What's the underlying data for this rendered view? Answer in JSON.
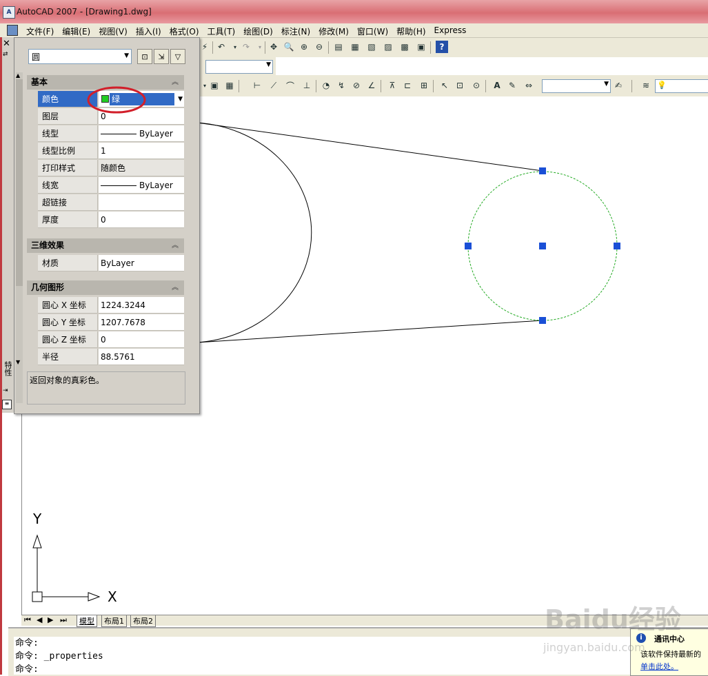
{
  "window": {
    "title": "AutoCAD 2007 - [Drawing1.dwg]",
    "app_icon": "autocad-logo"
  },
  "menu": [
    "文件(F)",
    "编辑(E)",
    "视图(V)",
    "插入(I)",
    "格式(O)",
    "工具(T)",
    "绘图(D)",
    "标注(N)",
    "修改(M)",
    "窗口(W)",
    "帮助(H)",
    "Express"
  ],
  "palette": {
    "object_type": "圆",
    "sections": {
      "basic": "基本",
      "effects3d": "三维效果",
      "geometry": "几何图形"
    },
    "basic": [
      {
        "key": "颜色",
        "value": "绿"
      },
      {
        "key": "图层",
        "value": "0"
      },
      {
        "key": "线型",
        "value": "ByLayer"
      },
      {
        "key": "线型比例",
        "value": "1"
      },
      {
        "key": "打印样式",
        "value": "随颜色"
      },
      {
        "key": "线宽",
        "value": "ByLayer"
      },
      {
        "key": "超链接",
        "value": ""
      },
      {
        "key": "厚度",
        "value": "0"
      }
    ],
    "effects3d": [
      {
        "key": "材质",
        "value": "ByLayer"
      }
    ],
    "geometry": [
      {
        "key": "圆心 X 坐标",
        "value": "1224.3244"
      },
      {
        "key": "圆心 Y 坐标",
        "value": "1207.7678"
      },
      {
        "key": "圆心 Z 坐标",
        "value": "0"
      },
      {
        "key": "半径",
        "value": "88.5761"
      }
    ],
    "description": "返回对象的真彩色。",
    "side_label": "特性",
    "color_swatch": "#22cc22",
    "highlight_color": "#316ac5"
  },
  "layout_tabs": [
    "模型",
    "布局1",
    "布局2"
  ],
  "ucs": {
    "x": "X",
    "y": "Y"
  },
  "command_lines": [
    "命令:",
    "命令: _properties",
    "命令:"
  ],
  "notification": {
    "title": "通讯中心",
    "text": "该软件保持最新的",
    "link": "单击此处。"
  },
  "watermark": {
    "brand": "Baidu经验",
    "url": "jingyan.baidu.com"
  },
  "colors": {
    "selected_circle": "#22aa22",
    "grip": "#1a4fd6",
    "annotation_circle": "#d21f2a"
  }
}
